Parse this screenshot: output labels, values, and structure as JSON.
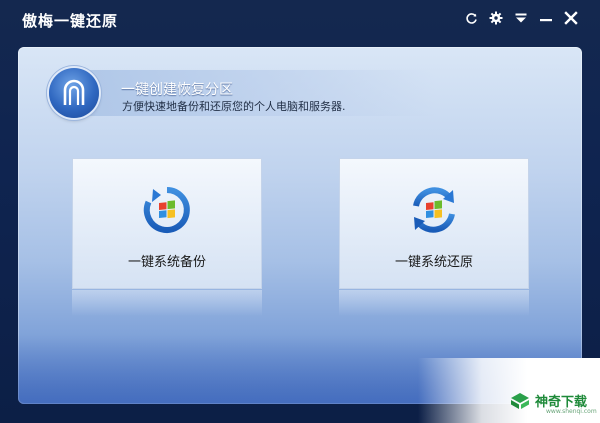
{
  "window": {
    "title": "傲梅一键还原",
    "controls": [
      {
        "name": "refresh-icon"
      },
      {
        "name": "gear-icon"
      },
      {
        "name": "menu-icon"
      },
      {
        "name": "minimize-icon"
      },
      {
        "name": "close-icon"
      }
    ]
  },
  "header": {
    "icon": "partition-arch-icon",
    "title": "一键创建恢复分区",
    "subtitle": "方便快速地备份和还原您的个人电脑和服务器."
  },
  "actions": [
    {
      "id": "backup",
      "label": "一键系统备份",
      "icon": "backup-windows-icon"
    },
    {
      "id": "restore",
      "label": "一键系统还原",
      "icon": "restore-windows-icon"
    }
  ],
  "watermark": {
    "text": "神奇下载",
    "url": "www.shenqi.com",
    "icon": "shenqi-logo-icon"
  },
  "colors": {
    "titlebar_bg": "#14284f",
    "panel_top": "#d9e6f6",
    "panel_bottom": "#4f78c4",
    "badge_blue": "#2f67c0",
    "watermark_green": "#1f8a3a"
  }
}
